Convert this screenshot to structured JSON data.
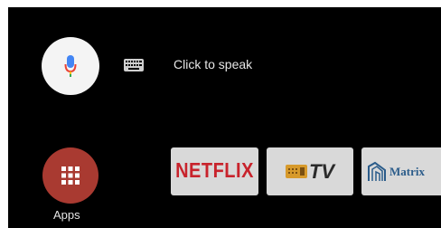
{
  "voice_search": {
    "prompt": "Click to speak",
    "icon": "microphone-icon",
    "keyboard_icon": "keyboard-icon"
  },
  "apps": {
    "label": "Apps",
    "icon": "grid-icon",
    "color": "#a93a31"
  },
  "tiles": [
    {
      "label": "NETFLIX",
      "color": "#c8232c"
    },
    {
      "label": "TV",
      "icon": "tv-icon"
    },
    {
      "label": "Matrix",
      "icon": "matrix-logo-icon",
      "color": "#2b5c8a"
    }
  ]
}
